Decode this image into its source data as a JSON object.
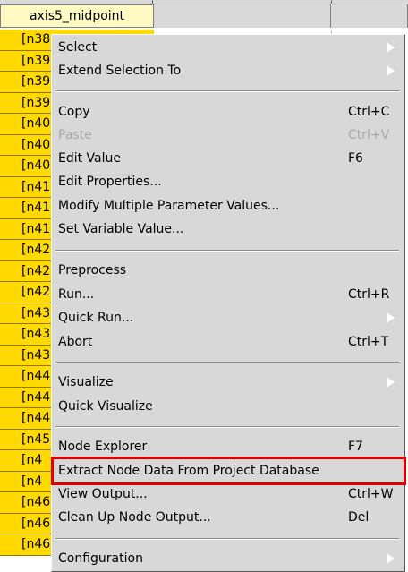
{
  "table": {
    "header": "axis5_midpoint",
    "rows": [
      "[n38",
      "[n39",
      "[n39",
      "[n39",
      "[n40",
      "[n40",
      "[n40",
      "[n41",
      "[n41",
      "[n41",
      "[n42",
      "[n42",
      "[n42",
      "[n43",
      "[n43",
      "[n43",
      "[n44",
      "[n44",
      "[n44",
      "[n45",
      "[n4",
      "[n4",
      "[n46",
      "[n46",
      "[n46"
    ]
  },
  "menu": {
    "select": "Select",
    "extend_selection": "Extend Selection To",
    "copy": "Copy",
    "copy_acc": "Ctrl+C",
    "paste": "Paste",
    "paste_acc": "Ctrl+V",
    "edit_value": "Edit Value",
    "edit_value_acc": "F6",
    "edit_properties": "Edit Properties...",
    "modify_multiple": "Modify Multiple Parameter Values...",
    "set_variable": "Set Variable Value...",
    "preprocess": "Preprocess",
    "run": "Run...",
    "run_acc": "Ctrl+R",
    "quick_run": "Quick Run...",
    "abort": "Abort",
    "abort_acc": "Ctrl+T",
    "visualize": "Visualize",
    "quick_visualize": "Quick Visualize",
    "node_explorer": "Node Explorer",
    "node_explorer_acc": "F7",
    "extract_node_data": "Extract Node Data From Project Database",
    "view_output": "View Output...",
    "view_output_acc": "Ctrl+W",
    "clean_up_output": "Clean Up Node Output...",
    "clean_up_output_acc": "Del",
    "configuration": "Configuration"
  },
  "colors": {
    "row_bg": "#ffd900",
    "header_bg": "#fff9c4",
    "menu_bg": "#d8d8d8",
    "highlight": "#e00000"
  }
}
